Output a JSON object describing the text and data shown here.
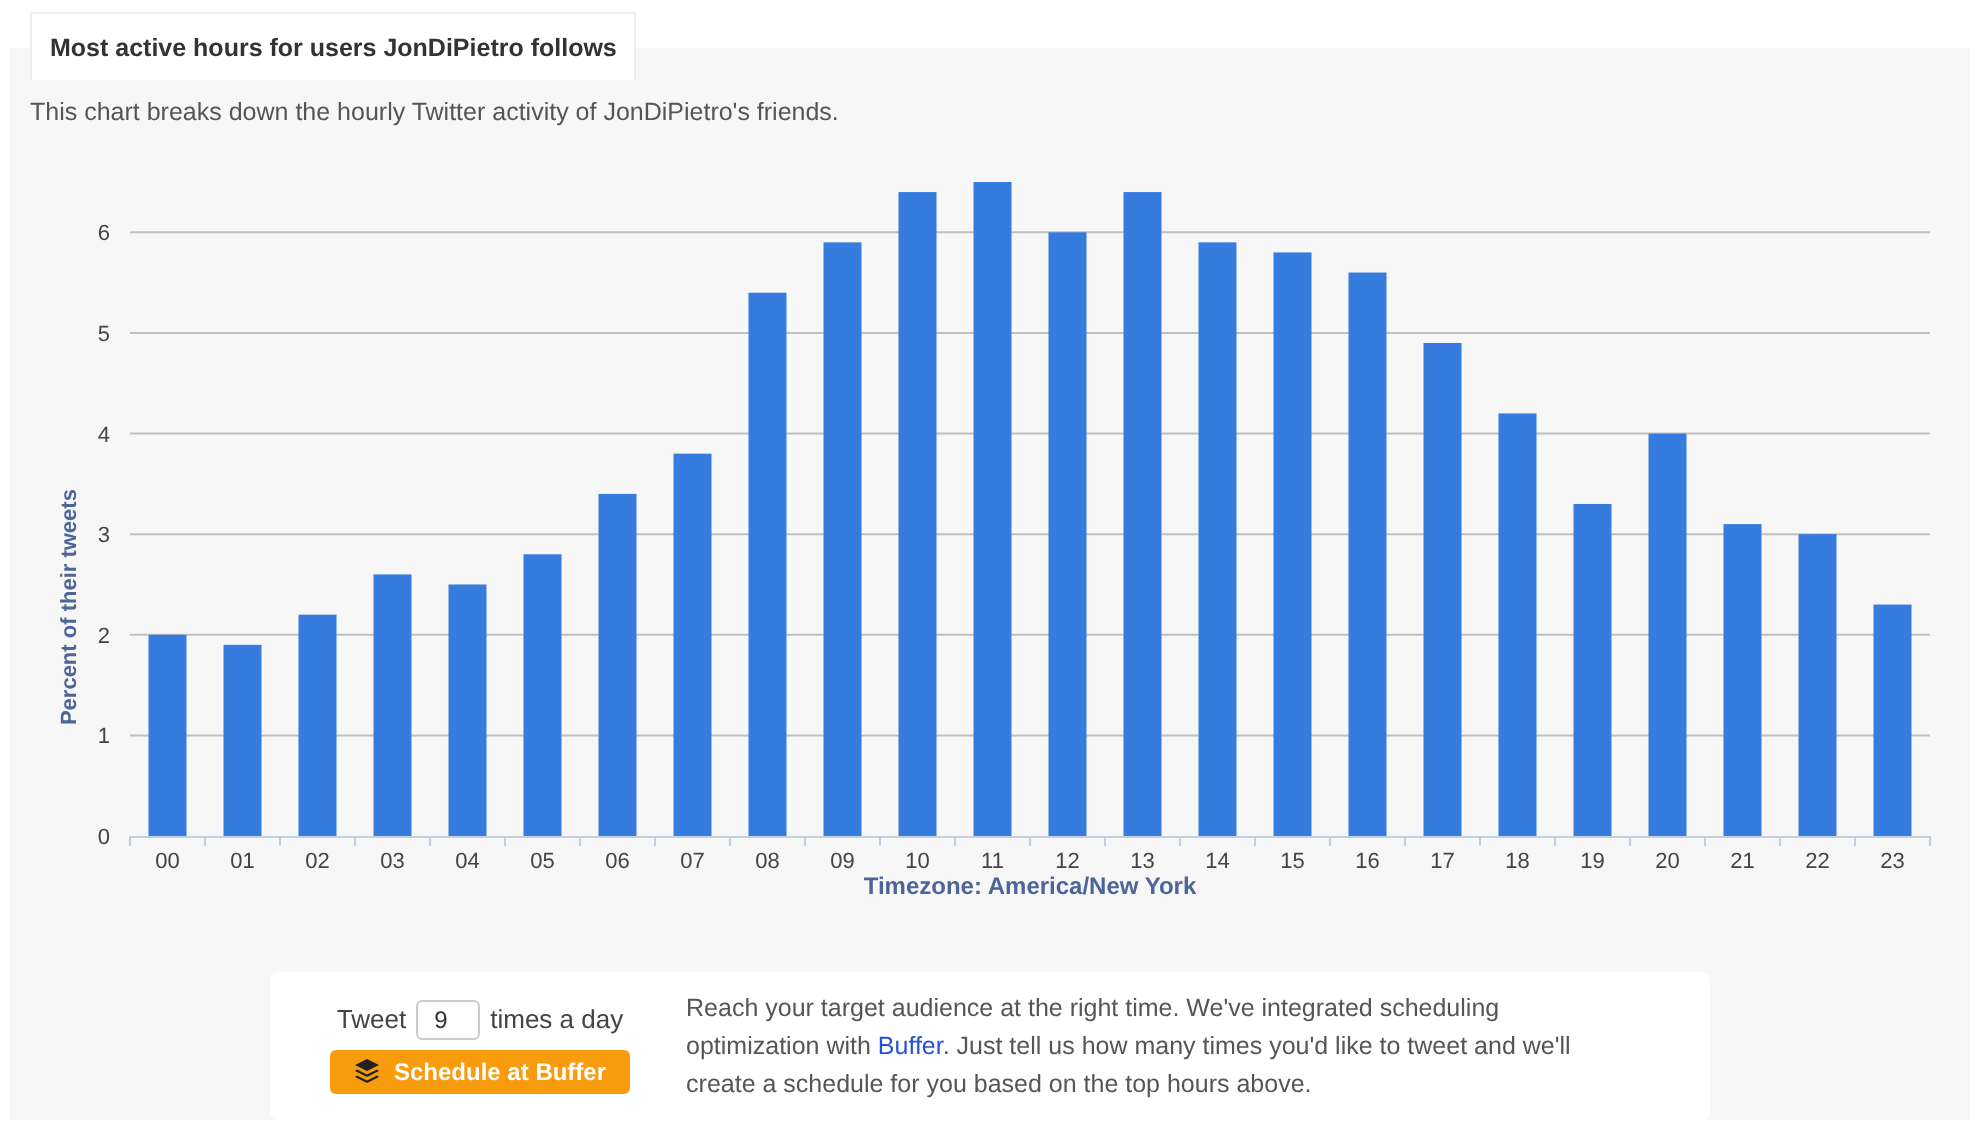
{
  "tab": {
    "title": "Most active hours for users JonDiPietro follows",
    "selected": true
  },
  "intro": "This chart breaks down the hourly Twitter activity of JonDiPietro's friends.",
  "chart_data": {
    "type": "bar",
    "xlabel": "Timezone: America/New York",
    "ylabel": "Percent of their tweets",
    "categories": [
      "00",
      "01",
      "02",
      "03",
      "04",
      "05",
      "06",
      "07",
      "08",
      "09",
      "10",
      "11",
      "12",
      "13",
      "14",
      "15",
      "16",
      "17",
      "18",
      "19",
      "20",
      "21",
      "22",
      "23"
    ],
    "grid": true,
    "series": [
      {
        "color": "#367cde",
        "values": [
          2.0,
          1.9,
          2.2,
          2.6,
          2.5,
          2.8,
          3.4,
          3.8,
          5.4,
          5.9,
          6.4,
          6.5,
          6.0,
          6.4,
          5.9,
          5.8,
          5.6,
          4.9,
          4.2,
          3.3,
          4.0,
          3.1,
          3.0,
          2.3
        ]
      }
    ],
    "ylim": [
      0,
      6.5
    ],
    "yticks": [
      0,
      1,
      2,
      3,
      4,
      5,
      6
    ]
  },
  "scheduler": {
    "prefix": "Tweet",
    "count": "9",
    "suffix": "times a day",
    "button": "Schedule at Buffer"
  },
  "description": {
    "before": "Reach your target audience at the right time. We've integrated scheduling optimization with ",
    "link": "Buffer",
    "after": ". Just tell us how many times you'd like to tweet and we'll create a schedule for you based on the top hours above."
  }
}
